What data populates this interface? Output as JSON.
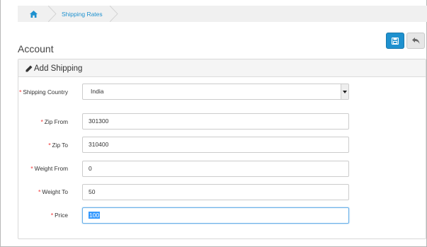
{
  "breadcrumb": {
    "home_icon": "home-icon",
    "items": [
      {
        "label": "Shipping Rates"
      }
    ]
  },
  "page": {
    "title": "Account"
  },
  "toolbar": {
    "save_icon": "save-icon",
    "back_icon": "reply-icon"
  },
  "colors": {
    "accent": "#1e91cf",
    "required": "#f56b6b",
    "focus": "#66afe9",
    "selection": "#3399ff"
  },
  "panel": {
    "title": "Add Shipping",
    "title_icon": "pencil-icon",
    "fields": {
      "country": {
        "label": "Shipping Country",
        "value": "India",
        "required": "*"
      },
      "zip_from": {
        "label": "Zip From",
        "value": "301300",
        "required": "*"
      },
      "zip_to": {
        "label": "Zip To",
        "value": "310400",
        "required": "*"
      },
      "weight_from": {
        "label": "Weight From",
        "value": "0",
        "required": "*"
      },
      "weight_to": {
        "label": "Weight To",
        "value": "50",
        "required": "*"
      },
      "price": {
        "label": "Price",
        "value": "100",
        "required": "*"
      }
    }
  }
}
